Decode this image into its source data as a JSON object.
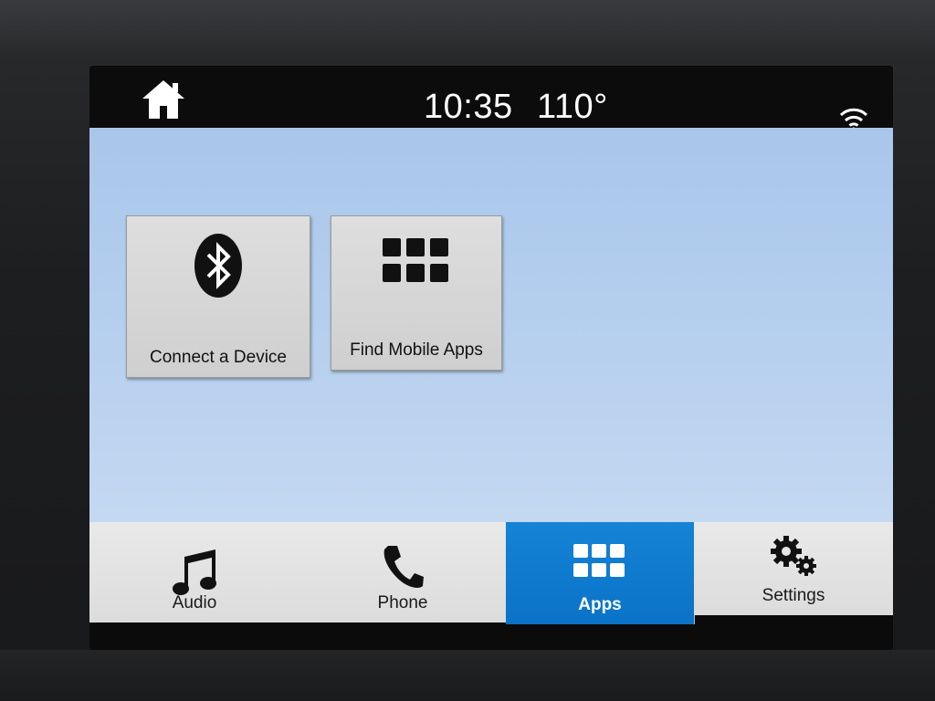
{
  "status_bar": {
    "time": "10:35",
    "temperature": "110°",
    "home_icon": "home-icon",
    "wifi_icon": "wifi-info-icon"
  },
  "tiles": [
    {
      "label": "Connect a Device",
      "icon": "bluetooth-icon"
    },
    {
      "label": "Find Mobile Apps",
      "icon": "apps-grid-icon"
    }
  ],
  "nav": {
    "items": [
      {
        "label": "Audio",
        "icon": "music-note-icon",
        "active": false
      },
      {
        "label": "Phone",
        "icon": "phone-icon",
        "active": false
      },
      {
        "label": "Apps",
        "icon": "apps-grid-icon",
        "active": true
      },
      {
        "label": "Settings",
        "icon": "gears-icon",
        "active": false
      }
    ]
  },
  "colors": {
    "accent": "#0a73c7",
    "background_sky": "#b5cfee",
    "tile": "#d6d6d6"
  }
}
